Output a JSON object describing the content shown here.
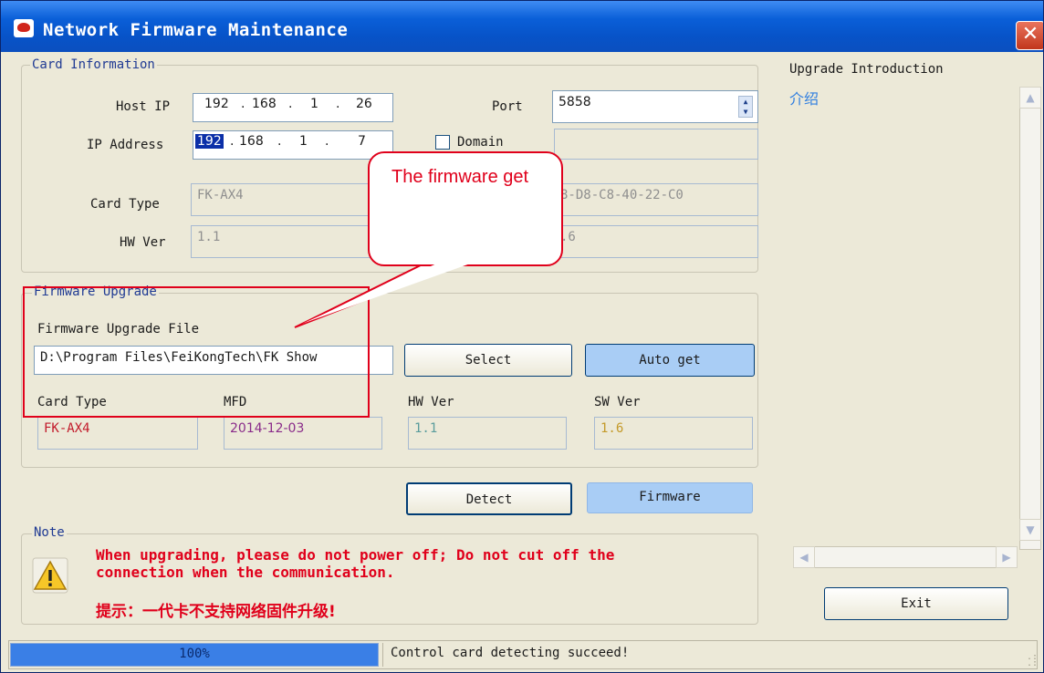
{
  "window": {
    "title": "Network Firmware Maintenance"
  },
  "card_info": {
    "legend": "Card Information",
    "host_ip_label": "Host IP",
    "host_ip": {
      "o1": "192",
      "o2": "168",
      "o3": "1",
      "o4": "26"
    },
    "port_label": "Port",
    "port_value": "5858",
    "ip_address_label": "IP Address",
    "ip_address": {
      "o1": "192",
      "o2": "168",
      "o3": "1",
      "o4": "7"
    },
    "domain_label": "Domain",
    "domain_value": "",
    "card_type_label": "Card Type",
    "card_type_value": "FK-AX4",
    "mac_value": "8-D8-C8-40-22-C0",
    "hw_ver_label": "HW Ver",
    "hw_ver_value": "1.1",
    "sw_ver_value": ".6"
  },
  "callout": {
    "text": "The firmware get"
  },
  "firmware_upgrade": {
    "legend": "Firmware Upgrade",
    "file_label": "Firmware Upgrade File",
    "file_path": "D:\\Program Files\\FeiKongTech\\FK Show",
    "select_label": "Select",
    "auto_get_label": "Auto get",
    "card_type_label": "Card Type",
    "card_type_value": "FK-AX4",
    "mfd_label": "MFD",
    "mfd_value": "2014-12-03",
    "hw_ver_label": "HW Ver",
    "hw_ver_value": "1.1",
    "sw_ver_label": "SW Ver",
    "sw_ver_value": "1.6"
  },
  "actions": {
    "detect_label": "Detect",
    "firmware_label": "Firmware"
  },
  "note": {
    "legend": "Note",
    "line1": "When upgrading, please do not power off; Do not cut off the",
    "line2": "connection when the communication.",
    "cn": "提示：一代卡不支持网络固件升级!"
  },
  "upgrade_intro": {
    "title": "Upgrade Introduction",
    "text": "介绍"
  },
  "exit_label": "Exit",
  "status": {
    "progress_text": "100%",
    "progress": 1.0,
    "message": "Control card detecting succeed!"
  },
  "colors": {
    "accent_red": "#e0001b",
    "progress_blue": "#3a7fe6",
    "titlebar_blue": "#0753c8"
  },
  "icons": [
    "window-app-icon",
    "close-icon",
    "warning-icon",
    "spin-up-icon",
    "spin-down-icon",
    "scroll-up-icon",
    "scroll-down-icon",
    "scroll-left-icon",
    "scroll-right-icon",
    "size-grip-icon"
  ]
}
